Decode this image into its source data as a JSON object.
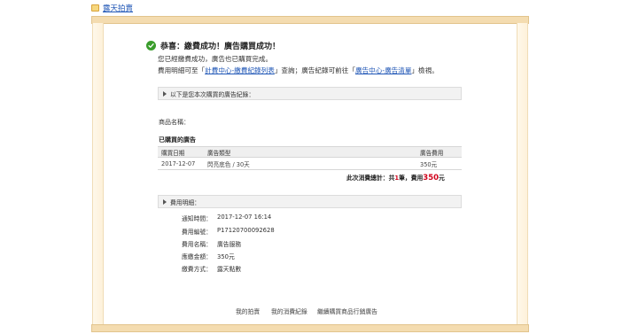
{
  "topnav": {
    "link": "露天拍賣"
  },
  "success": {
    "title": "恭喜：繳費成功！廣告購買成功！",
    "line1": "您已經繳費成功，廣告也已購買完成。",
    "line2_prefix": "費用明細可至「",
    "line2_link1": "計費中心-繳費紀錄列表",
    "line2_mid": "」查詢；廣告紀錄可前往「",
    "line2_link2": "廣告中心-廣告清單",
    "line2_suffix": "」檢視。"
  },
  "purchase_section": {
    "title": "以下是您本次購買的廣告紀錄："
  },
  "product": {
    "label": "商品名稱："
  },
  "ads": {
    "heading": "已購買的廣告",
    "columns": [
      "購買日期",
      "廣告類型",
      "廣告費用"
    ],
    "rows": [
      {
        "date": "2017-12-07",
        "type": "閃亮底色 / 30天",
        "cost": "350元"
      }
    ],
    "total_prefix": "此次消費總計：共",
    "total_count": "1",
    "total_mid": "筆，費用",
    "total_amount": "350",
    "total_suffix": "元"
  },
  "fee_section": {
    "title": "費用明細："
  },
  "fee_details": [
    {
      "label": "通知時間：",
      "value": "2017-12-07 16:14"
    },
    {
      "label": "費用編號：",
      "value": "P17120700092628"
    },
    {
      "label": "費用名稱：",
      "value": "廣告服務"
    },
    {
      "label": "應繳金額：",
      "value": "350元"
    },
    {
      "label": "繳費方式：",
      "value": "露天點數"
    }
  ],
  "footer": {
    "links": [
      "我的拍賣",
      "我的消費紀錄",
      "繼續購買商品行銷廣告"
    ]
  }
}
